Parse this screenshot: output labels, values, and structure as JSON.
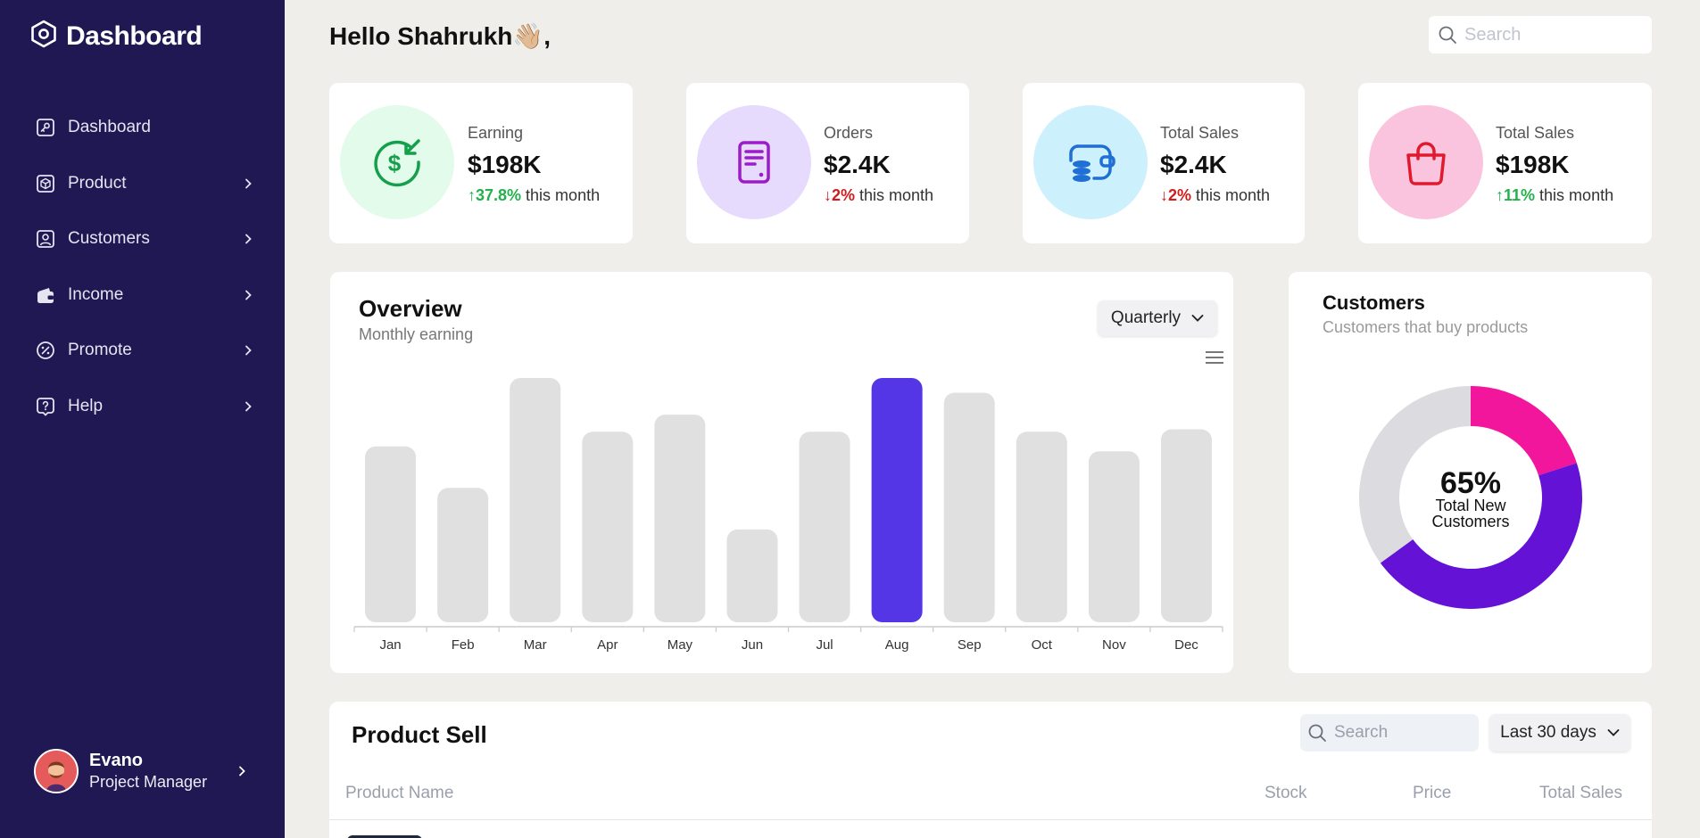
{
  "sidebar": {
    "title": "Dashboard",
    "items": [
      {
        "label": "Dashboard",
        "icon": "key-square-icon"
      },
      {
        "label": "Product",
        "icon": "cube-icon"
      },
      {
        "label": "Customers",
        "icon": "user-square-icon"
      },
      {
        "label": "Income",
        "icon": "wallet-icon"
      },
      {
        "label": "Promote",
        "icon": "discount-icon"
      },
      {
        "label": "Help",
        "icon": "help-square-icon"
      }
    ],
    "profile": {
      "name": "Evano",
      "role": "Project Manager"
    }
  },
  "header": {
    "greeting": "Hello Shahrukh👋🏼,",
    "search_placeholder": "Search"
  },
  "stats": [
    {
      "label": "Earning",
      "value": "$198K",
      "change": "↑37.8%",
      "suffix": " this month",
      "trend": "up",
      "icon": "dollar-return-icon",
      "bg": "#e2fbea",
      "fg": "#14a04a"
    },
    {
      "label": "Orders",
      "value": "$2.4K",
      "change": "↓2%",
      "suffix": " this month",
      "trend": "down",
      "icon": "document-icon",
      "bg": "#e6dafd",
      "fg": "#9b1dc9"
    },
    {
      "label": "Total Sales",
      "value": "$2.4K",
      "change": "↓2%",
      "suffix": " this month",
      "trend": "down",
      "icon": "coins-wallet-icon",
      "bg": "#cdf0fd",
      "fg": "#1f6fd4"
    },
    {
      "label": "Total Sales",
      "value": "$198K",
      "change": "↑11%",
      "suffix": " this month",
      "trend": "up",
      "icon": "shopping-bag-icon",
      "bg": "#fbc4de",
      "fg": "#e0192c"
    }
  ],
  "overview": {
    "title": "Overview",
    "subtitle": "Monthly earning",
    "period": "Quarterly"
  },
  "customers": {
    "title": "Customers",
    "subtitle": "Customers that buy products",
    "percent_label": "65%",
    "line1": "Total New",
    "line2": "Customers"
  },
  "product_sell": {
    "title": "Product Sell",
    "search_placeholder": "Search",
    "range": "Last 30 days",
    "columns": [
      "Product Name",
      "Stock",
      "Price",
      "Total Sales"
    ]
  },
  "colors": {
    "sidebar_bg": "#1f1853",
    "accent": "#5536e6",
    "bar": "#e0e0e0",
    "donut_pink": "#f2169c",
    "donut_purple": "#6412d6",
    "donut_track": "#dcdbe0"
  },
  "chart_data": [
    {
      "type": "bar",
      "categories": [
        "Jan",
        "Feb",
        "Mar",
        "Apr",
        "May",
        "Jun",
        "Jul",
        "Aug",
        "Sep",
        "Oct",
        "Nov",
        "Dec"
      ],
      "values": [
        72,
        55,
        100,
        78,
        85,
        38,
        78,
        100,
        94,
        78,
        70,
        79
      ],
      "highlight": "Aug",
      "title": "Overview",
      "subtitle": "Monthly earning",
      "xlabel": "",
      "ylabel": "",
      "ylim": [
        0,
        100
      ],
      "grid": false
    },
    {
      "type": "pie",
      "title": "Customers",
      "subtitle": "Customers that buy products",
      "slices": [
        {
          "value": 20,
          "color": "#f2169c"
        },
        {
          "value": 45,
          "color": "#6412d6"
        },
        {
          "value": 35,
          "color": "#dcdbe0"
        }
      ],
      "center_label": "65%"
    }
  ]
}
